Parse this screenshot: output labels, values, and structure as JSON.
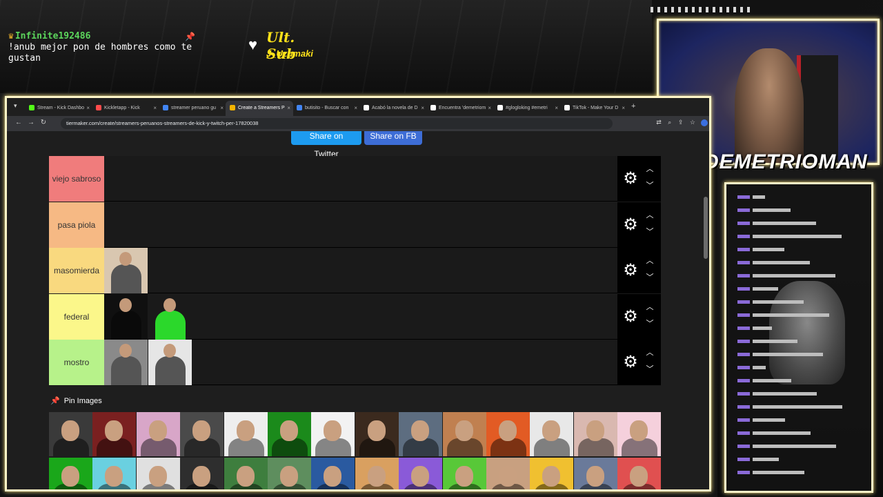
{
  "overlay": {
    "chat_user": "Infinite192486",
    "chat_text": "!anub mejor pon de hombres como te gustan",
    "ult_sub_title": "Ult. Sub",
    "ult_sub_name": "J_Uzumaki",
    "streamer_name": "DEMETRIOMAN",
    "colors": {
      "frame": "#fff6c8",
      "accent_yellow": "#ffe21a",
      "chat_user": "#5cd65c"
    }
  },
  "browser": {
    "tabs": [
      {
        "label": "Stream - Kick Dashbo",
        "icon_color": "#53fc18"
      },
      {
        "label": "Kickletapp - Kick",
        "icon_color": "#ff4b4b"
      },
      {
        "label": "streamer peruano gu",
        "icon_color": "#4285f4"
      },
      {
        "label": "Create a Streamers P",
        "icon_color": "#f4b400",
        "active": true
      },
      {
        "label": "butisito - Buscar con",
        "icon_color": "#4285f4"
      },
      {
        "label": "Acabó la novela de D",
        "icon_color": "#ffffff"
      },
      {
        "label": "Encuentra 'demetriom",
        "icon_color": "#ffffff"
      },
      {
        "label": "#glogloking #emetri",
        "icon_color": "#ffffff"
      },
      {
        "label": "TikTok - Make Your D",
        "icon_color": "#ffffff"
      }
    ],
    "url": "tiermaker.com/create/streamers-peruanos-streamers-de-kick-y-twitch-per-17820038"
  },
  "page": {
    "share_twitter": "Share on Twitter",
    "share_fb": "Share on FB",
    "pin_images": "Pin Images",
    "tiers": [
      {
        "label": "viejo sabroso",
        "color": "#f07c7c",
        "items": []
      },
      {
        "label": "pasa piola",
        "color": "#f6b984",
        "items": []
      },
      {
        "label": "masomierda",
        "color": "#f9d97f",
        "items": [
          "#d9c7b0"
        ]
      },
      {
        "label": "federal",
        "color": "#fbf78a",
        "items": [
          "#101010",
          "#1a1a1a"
        ]
      },
      {
        "label": "mostro",
        "color": "#b7f28a",
        "items": [
          "#8a8a8a",
          "#e6e6e6"
        ]
      }
    ],
    "gallery_colors": [
      [
        "#3a3a3a",
        "#7a2020",
        "#d8a6c8",
        "#4a4a4a",
        "#eeeeee",
        "#1b8a1b",
        "#f2f2f2",
        "#3b2a1e",
        "#5d6d80",
        "#c08050",
        "#e25b24",
        "#e8e8e8",
        "#d9b8b0",
        "#f5d0dc"
      ],
      [
        "#1aa71a",
        "#6ad0e0",
        "#e0e0e0",
        "#2e2e2e",
        "#3e7e3e",
        "#5e8e5e",
        "#2a5aa0",
        "#d9a060",
        "#8a5ad8",
        "#58c838",
        "#c8a080",
        "#f0c030",
        "#6a7a9a",
        "#e05050"
      ]
    ]
  }
}
